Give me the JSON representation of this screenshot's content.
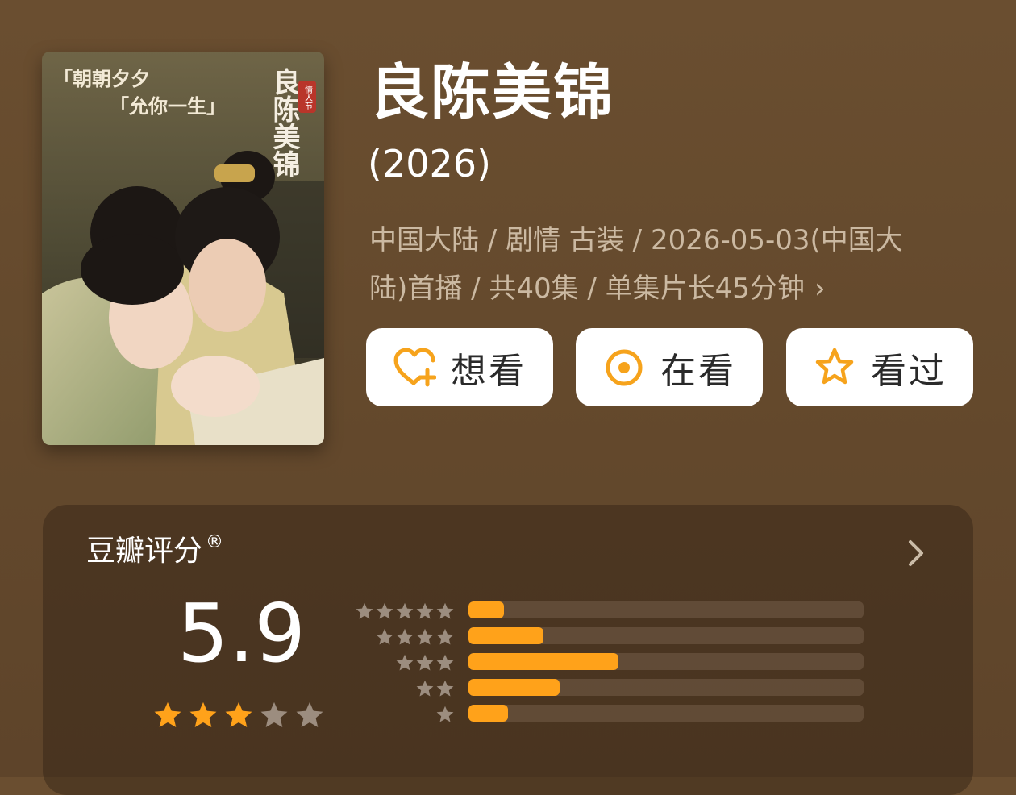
{
  "poster": {
    "top_text_line1": "「朝朝夕夕",
    "top_text_line2": "「允你一生」",
    "calligraphy": "良陈美锦",
    "seal": "情人节"
  },
  "title": "良陈美锦",
  "year": "(2026)",
  "meta_line1": "中国大陆 / 剧情 古装 / 2026-05-03(中国大",
  "meta_line2": "陆)首播 / 共40集 / 单集片长45分钟",
  "meta_more": "›",
  "actions": {
    "want": "想看",
    "watching": "在看",
    "watched": "看过"
  },
  "rating": {
    "title": "豆瓣评分",
    "registered_mark": "®",
    "score": "5.9",
    "score_stars_filled": 3,
    "score_stars_total": 5,
    "distribution": [
      {
        "stars": 5,
        "fraction": 0.09
      },
      {
        "stars": 4,
        "fraction": 0.19
      },
      {
        "stars": 3,
        "fraction": 0.38
      },
      {
        "stars": 2,
        "fraction": 0.23
      },
      {
        "stars": 1,
        "fraction": 0.1
      }
    ]
  },
  "colors": {
    "accent": "#ffa21a",
    "star_on": "#ffa21a",
    "star_off": "#9c8d7f",
    "background": "#654a2d"
  },
  "icons": {
    "want": "heart-plus-icon",
    "watching": "target-circle-icon",
    "watched": "star-outline-icon",
    "more": "chevron-right-icon"
  }
}
